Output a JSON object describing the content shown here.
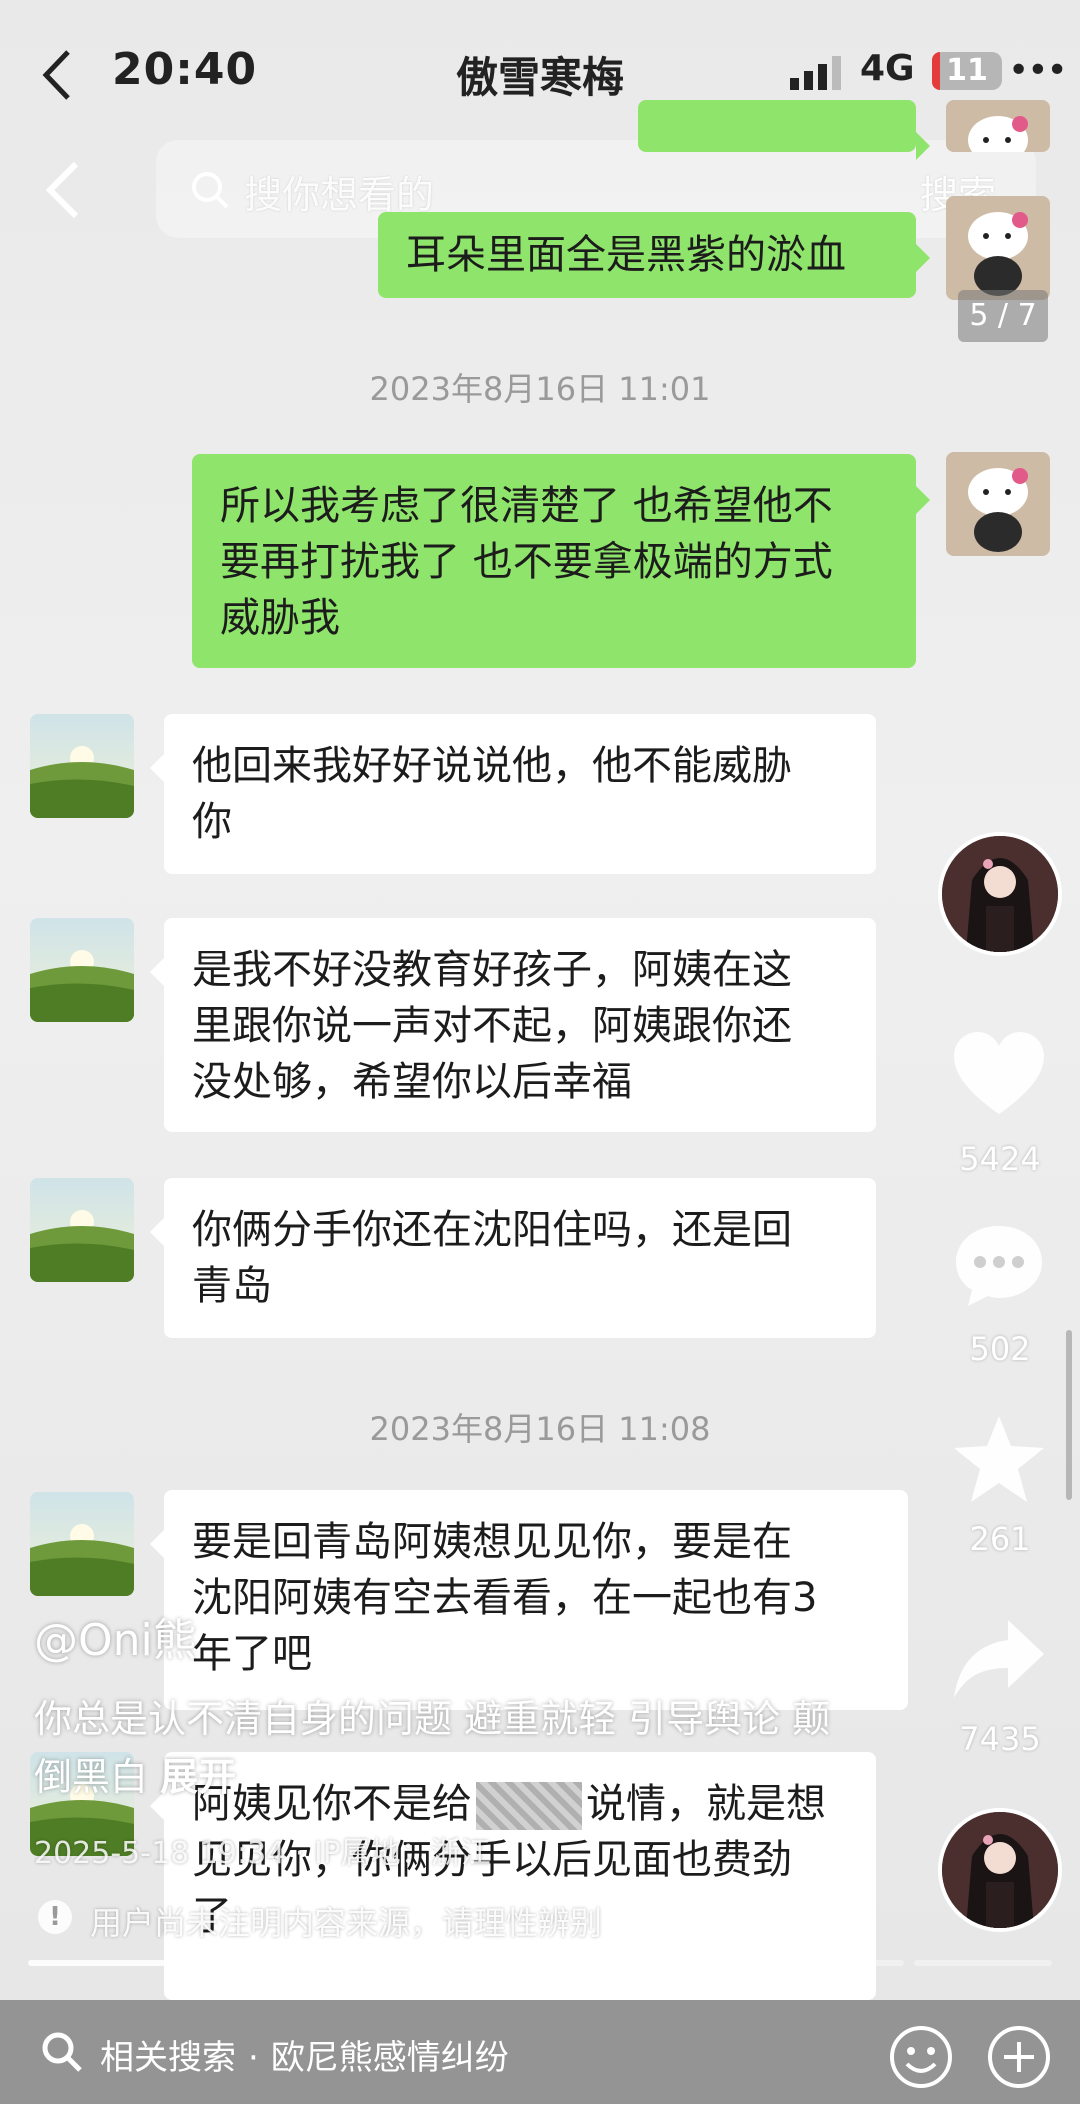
{
  "status_bar": {
    "time": "20:40",
    "network": "4G",
    "battery": "11"
  },
  "chat": {
    "title": "傲雪寒梅",
    "more": "•••"
  },
  "overlay_search": {
    "placeholder": "搜你想看的",
    "button": "搜索"
  },
  "image_pager": "5 / 7",
  "messages": [
    {
      "side": "self",
      "text": "耳朵里面全是黑紫的淤血"
    },
    {
      "side": "timestamp",
      "text": "2023年8月16日 11:01"
    },
    {
      "side": "self",
      "lines": [
        "所以我考虑了很清楚了 也希望他不",
        "要再打扰我了 也不要拿极端的方式",
        "威胁我"
      ]
    },
    {
      "side": "other",
      "lines": [
        "他回来我好好说说他，他不能威胁",
        "你"
      ]
    },
    {
      "side": "other",
      "lines": [
        "是我不好没教育好孩子，阿姨在这",
        "里跟你说一声对不起，阿姨跟你还",
        "没处够，希望你以后幸福"
      ]
    },
    {
      "side": "other",
      "lines": [
        "你俩分手你还在沈阳住吗，还是回",
        "青岛"
      ]
    },
    {
      "side": "timestamp",
      "text": "2023年8月16日 11:08"
    },
    {
      "side": "other",
      "lines": [
        "要是回青岛阿姨想见见你，要是在",
        "沈阳阿姨有空去看看，在一起也有3",
        "年了吧"
      ]
    },
    {
      "side": "other",
      "lines": [
        "阿姨见你不是给",
        "说情，就是想",
        "见见你，你俩分手以后见面也费劲",
        "了"
      ]
    }
  ],
  "rail": {
    "likes": "5424",
    "comments": "502",
    "favorites": "261",
    "shares": "7435"
  },
  "post": {
    "author": "@Oni熊",
    "caption": "你总是认不清自身的问题 避重就轻 引导舆论 颠倒黑白",
    "expand": "展开",
    "meta": "2025-5-18 19:34 · IP属地：浙江",
    "notice": "用户尚未注明内容来源，请理性辨别",
    "progress_segments": 7,
    "progress_current": 5
  },
  "bottom_bar": {
    "label": "相关搜索",
    "separator": "·",
    "query": "欧尼熊感情纠纷"
  },
  "colors": {
    "self_bubble": "#8fe56b",
    "other_bubble": "#ffffff",
    "timestamp": "#9a9a9a"
  }
}
